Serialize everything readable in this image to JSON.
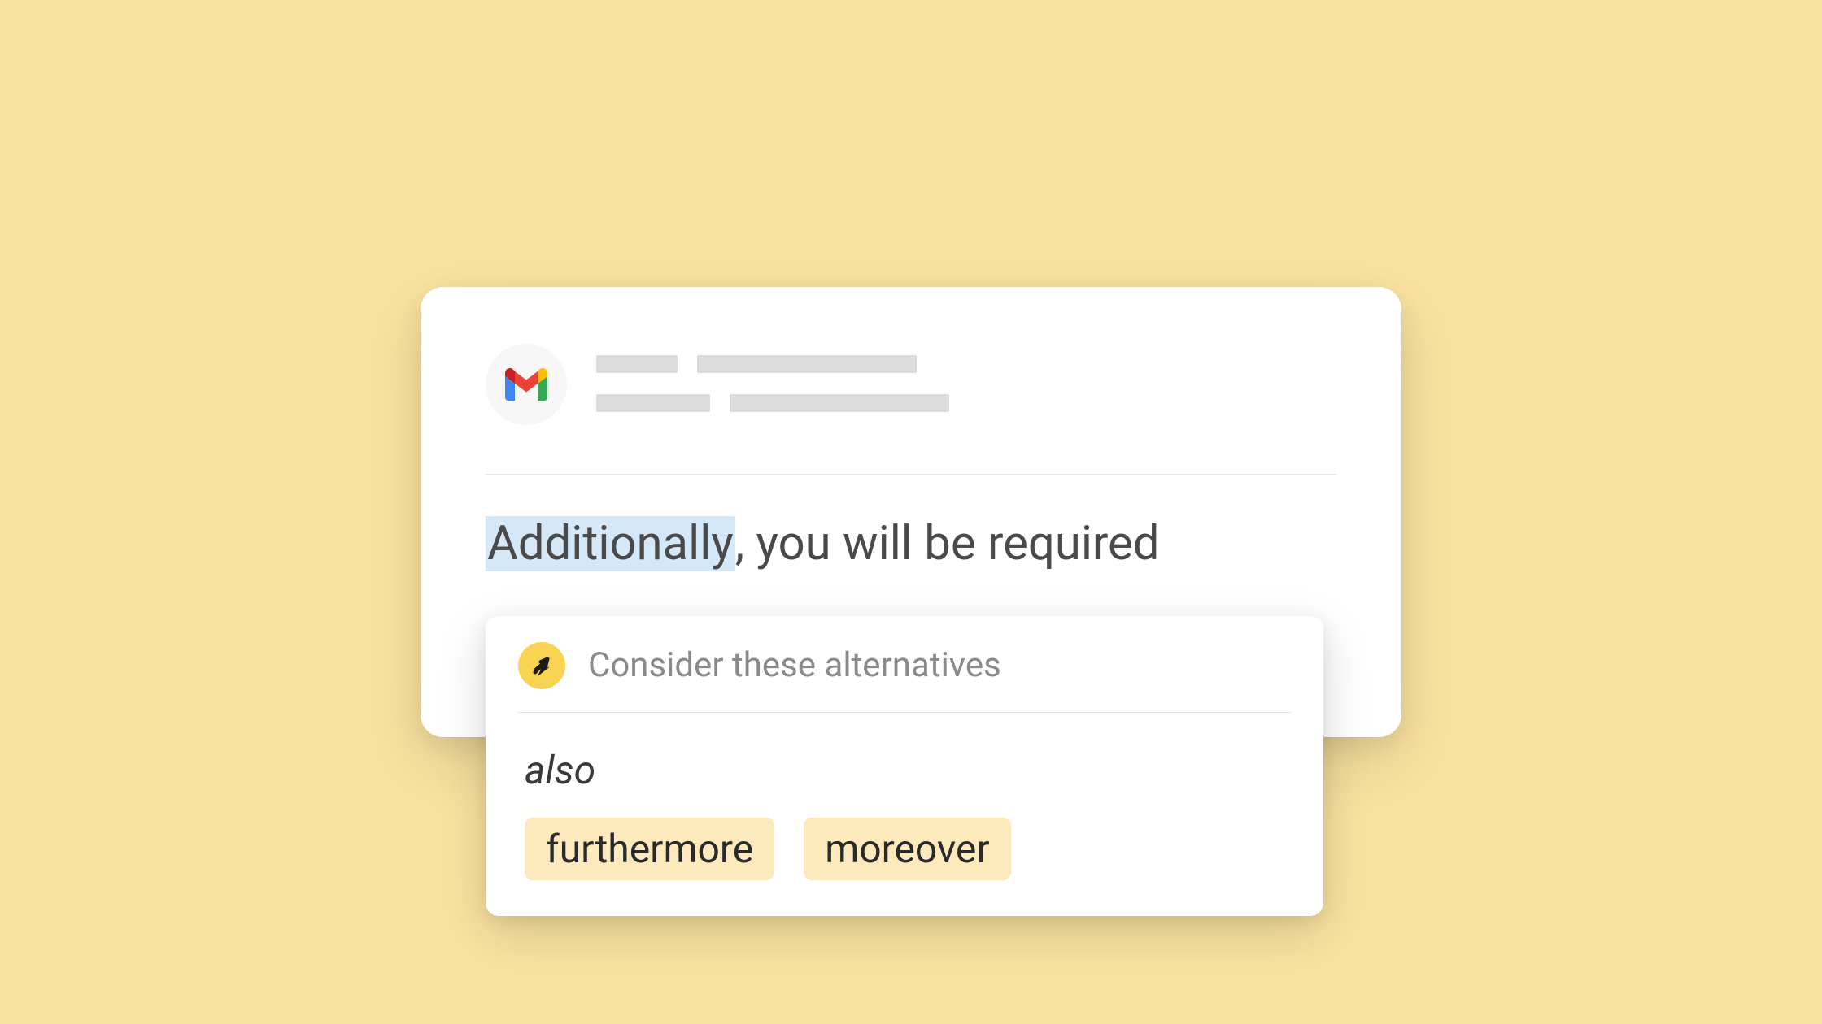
{
  "email": {
    "body": {
      "highlighted_word": "Additionally",
      "punctuation": ",",
      "rest": " you will be required"
    }
  },
  "suggestion": {
    "title": "Consider these alternatives",
    "alternatives": {
      "plain": "also",
      "chips": [
        "furthermore",
        "moreover"
      ]
    }
  }
}
